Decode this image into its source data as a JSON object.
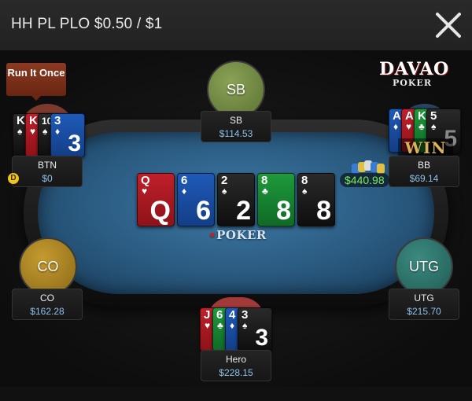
{
  "window": {
    "title": "HH PL PLO $0.50 / $1"
  },
  "brand": {
    "name": "DAVAO",
    "sub": "POKER",
    "felt_logo": "POKER"
  },
  "run_it_once_label": "Run It Once",
  "dealer_label": "D",
  "pot": "$440.98",
  "win_label": "WIN",
  "board": [
    {
      "rank": "Q",
      "suit": "♥",
      "color": "hearts"
    },
    {
      "rank": "6",
      "suit": "♦",
      "color": "diamonds"
    },
    {
      "rank": "2",
      "suit": "♠",
      "color": "spades"
    },
    {
      "rank": "8",
      "suit": "♣",
      "color": "clubs"
    },
    {
      "rank": "8",
      "suit": "♠",
      "color": "spades"
    }
  ],
  "seats": {
    "sb": {
      "avatar": "SB",
      "name": "SB",
      "stack": "$114.53"
    },
    "btn": {
      "name": "BTN",
      "stack": "$0",
      "cards": [
        {
          "rank": "K",
          "suit": "♠"
        },
        {
          "rank": "K",
          "suit": "♥"
        },
        {
          "rank": "10",
          "suit": "♠"
        },
        {
          "rank": "3",
          "suit": "♦"
        }
      ]
    },
    "bb": {
      "name": "BB",
      "stack": "$69.14",
      "cards": [
        {
          "rank": "A",
          "suit": "♦"
        },
        {
          "rank": "A",
          "suit": "♥"
        },
        {
          "rank": "K",
          "suit": "♣"
        },
        {
          "rank": "5",
          "suit": "♠"
        }
      ]
    },
    "co": {
      "avatar": "CO",
      "name": "CO",
      "stack": "$162.28"
    },
    "utg": {
      "avatar": "UTG",
      "name": "UTG",
      "stack": "$215.70"
    },
    "hero": {
      "name": "Hero",
      "stack": "$228.15",
      "cards": [
        {
          "rank": "J",
          "suit": "♥"
        },
        {
          "rank": "6",
          "suit": "♣"
        },
        {
          "rank": "4",
          "suit": "♦"
        },
        {
          "rank": "3",
          "suit": "♠"
        }
      ]
    }
  }
}
